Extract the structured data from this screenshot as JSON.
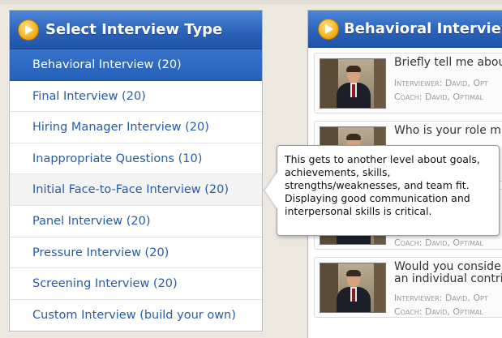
{
  "left_panel": {
    "title": "Select Interview Type",
    "items": [
      {
        "label": "Behavioral Interview (20)"
      },
      {
        "label": "Final Interview (20)"
      },
      {
        "label": "Hiring Manager Interview (20)"
      },
      {
        "label": "Inappropriate Questions (10)"
      },
      {
        "label": "Initial Face-to-Face Interview (20)"
      },
      {
        "label": "Panel Interview (20)"
      },
      {
        "label": "Pressure Interview (20)"
      },
      {
        "label": "Screening Interview (20)"
      },
      {
        "label": "Custom Interview (build your own)"
      }
    ],
    "selected_index": 0,
    "hovered_index": 4
  },
  "right_panel": {
    "title": "Behavioral Interview (",
    "questions": [
      {
        "text": "Briefly tell me abou",
        "interviewer": "Interviewer: David, Opt",
        "coach": "Coach: David, Optimal"
      },
      {
        "text": "Who is your role m",
        "interviewer": "",
        "coach": ""
      },
      {
        "text": "",
        "interviewer": "",
        "coach": "Coach: David, Optimal"
      },
      {
        "text_line1": "Would you conside",
        "text_line2": "an individual contrib",
        "interviewer": "Interviewer: David, Opt",
        "coach": "Coach: David, Optimal"
      }
    ]
  },
  "tooltip": {
    "lines": [
      "This gets to another level about goals,",
      "achievements, skills,",
      "strengths/weaknesses, and team fit.",
      "Displaying good communication and",
      "interpersonal skills is critical."
    ]
  },
  "icons": {
    "header_icon": "play-circle-icon"
  },
  "colors": {
    "header_blue": "#2b63b9",
    "link_blue": "#2a5aa8",
    "icon_gold": "#f6b626"
  }
}
